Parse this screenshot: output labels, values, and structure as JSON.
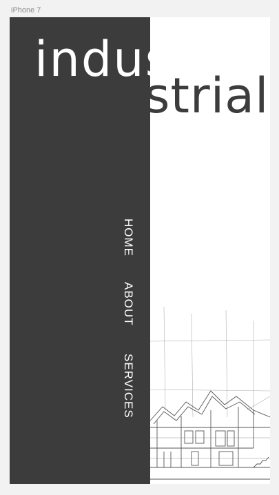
{
  "device": {
    "label": "iPhone 7"
  },
  "hero": {
    "title_part1": "indus",
    "title_part2": "strial"
  },
  "nav": {
    "items": [
      {
        "label": "HOME"
      },
      {
        "label": "ABOUT"
      },
      {
        "label": "SERVICES"
      }
    ]
  },
  "colors": {
    "panel": "#3d3c3c",
    "background": "#ffffff",
    "text_light": "#ffffff",
    "text_dark": "#3d3c3c"
  },
  "illustration": {
    "icon": "architectural-house-sketch"
  }
}
